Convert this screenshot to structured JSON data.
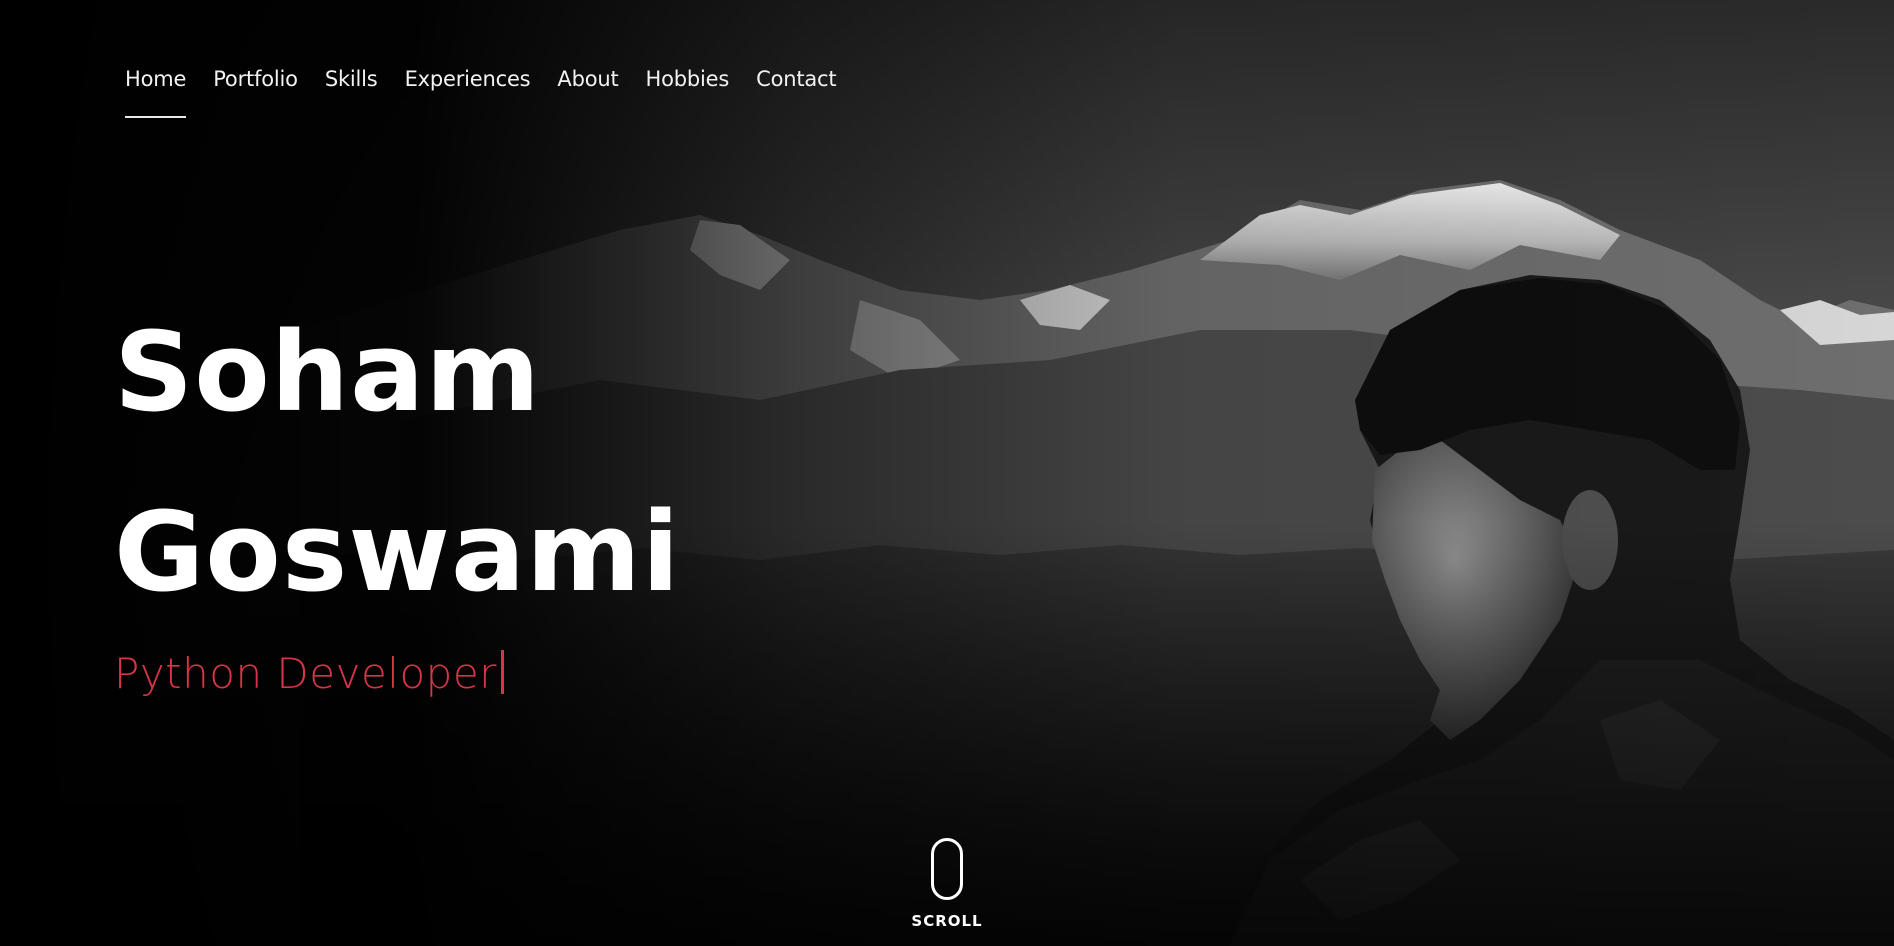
{
  "nav": {
    "items": [
      {
        "label": "Home",
        "active": true
      },
      {
        "label": "Portfolio",
        "active": false
      },
      {
        "label": "Skills",
        "active": false
      },
      {
        "label": "Experiences",
        "active": false
      },
      {
        "label": "About",
        "active": false
      },
      {
        "label": "Hobbies",
        "active": false
      },
      {
        "label": "Contact",
        "active": false
      }
    ]
  },
  "hero": {
    "first_name": "Soham",
    "last_name": "Goswami",
    "role": "Python Developer",
    "scroll_label": "SCROLL"
  },
  "colors": {
    "accent": "#d73448",
    "text": "#ffffff",
    "background": "#000000"
  }
}
